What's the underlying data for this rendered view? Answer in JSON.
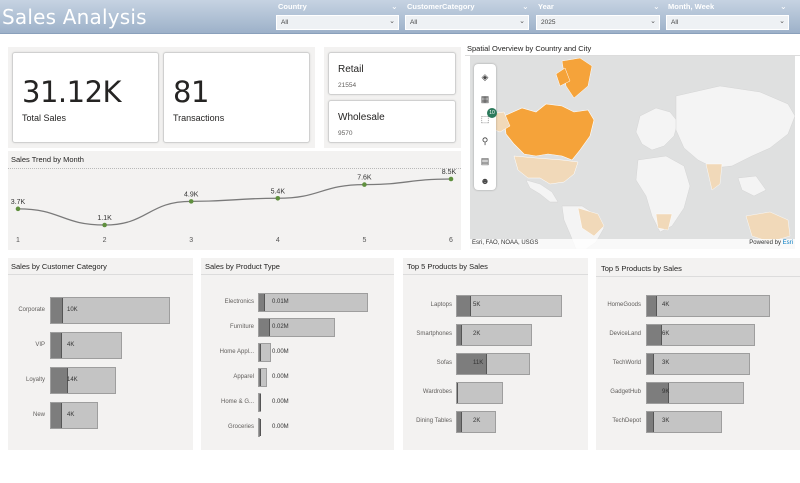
{
  "header": {
    "title": "Sales Analysis",
    "slicers": [
      {
        "label": "Country",
        "value": "All"
      },
      {
        "label": "CustomerCategory",
        "value": "All"
      },
      {
        "label": "Year",
        "value": "2025"
      },
      {
        "label": "Month, Week",
        "value": "All"
      }
    ]
  },
  "kpis": {
    "total_sales": {
      "value": "31.12K",
      "label": "Total Sales"
    },
    "transactions": {
      "value": "81",
      "label": "Transactions"
    }
  },
  "segments": {
    "retail": {
      "label": "Retail",
      "value": "21554"
    },
    "wholesale": {
      "label": "Wholesale",
      "value": "9570"
    }
  },
  "trend": {
    "title": "Sales Trend by Month",
    "chart_data": {
      "type": "line",
      "x": [
        1,
        2,
        3,
        4,
        5,
        6
      ],
      "y": [
        3.7,
        1.1,
        4.9,
        5.4,
        7.6,
        8.5
      ],
      "labels": [
        "3.7K",
        "1.1K",
        "4.9K",
        "5.4K",
        "7.6K",
        "8.5K"
      ],
      "ylabel": "",
      "xlabel": ""
    }
  },
  "map": {
    "title": "Spatial Overview by Country and City",
    "credit": "Esri, FAO, NOAA, USGS",
    "powered_by": "Powered by",
    "powered_brand": "Esri",
    "badge": "10",
    "colors": {
      "highlight": "#f5a33a",
      "light": "#f1d9b9",
      "land": "#f4f4f4",
      "water": "#dfe0e0"
    }
  },
  "charts": {
    "customer_category": {
      "title": "Sales by Customer Category",
      "chart_data": {
        "type": "bar",
        "categories": [
          "Corporate",
          "VIP",
          "Loyalty",
          "New"
        ],
        "labels": [
          "10K",
          "4K",
          "14K",
          "4K"
        ],
        "values": [
          10,
          4,
          14,
          4
        ],
        "bg": [
          100,
          60,
          55,
          40
        ]
      }
    },
    "product_type": {
      "title": "Sales by Product Type",
      "chart_data": {
        "type": "bar",
        "categories": [
          "Electronics",
          "Furniture",
          "Home Appl...",
          "Apparel",
          "Home & G...",
          "Groceries"
        ],
        "labels": [
          "0.01M",
          "0.02M",
          "0.00M",
          "0.00M",
          "0.00M",
          "0.00M"
        ],
        "values": [
          0.01,
          0.02,
          0.0,
          0.0,
          0.0,
          0.0
        ],
        "bg": [
          100,
          70,
          12,
          8,
          3,
          1
        ]
      }
    },
    "top_products": {
      "title": "Top 5 Products by Sales",
      "chart_data": {
        "type": "bar",
        "categories": [
          "Laptops",
          "Smartphones",
          "Sofas",
          "Wardrobes",
          "Dining Tables"
        ],
        "labels": [
          "5K",
          "2K",
          "11K",
          "",
          "2K"
        ],
        "values": [
          5,
          2,
          11,
          0,
          2
        ],
        "bg": [
          100,
          72,
          70,
          44,
          38
        ]
      }
    },
    "top_brands": {
      "title": "Top 5 Products by Sales",
      "chart_data": {
        "type": "bar",
        "categories": [
          "HomeGoods",
          "DeviceLand",
          "TechWorld",
          "GadgetHub",
          "TechDepot"
        ],
        "labels": [
          "4K",
          "6K",
          "3K",
          "9K",
          "3K"
        ],
        "values": [
          4,
          6,
          3,
          9,
          3
        ],
        "bg": [
          100,
          88,
          84,
          79,
          61
        ]
      }
    }
  }
}
